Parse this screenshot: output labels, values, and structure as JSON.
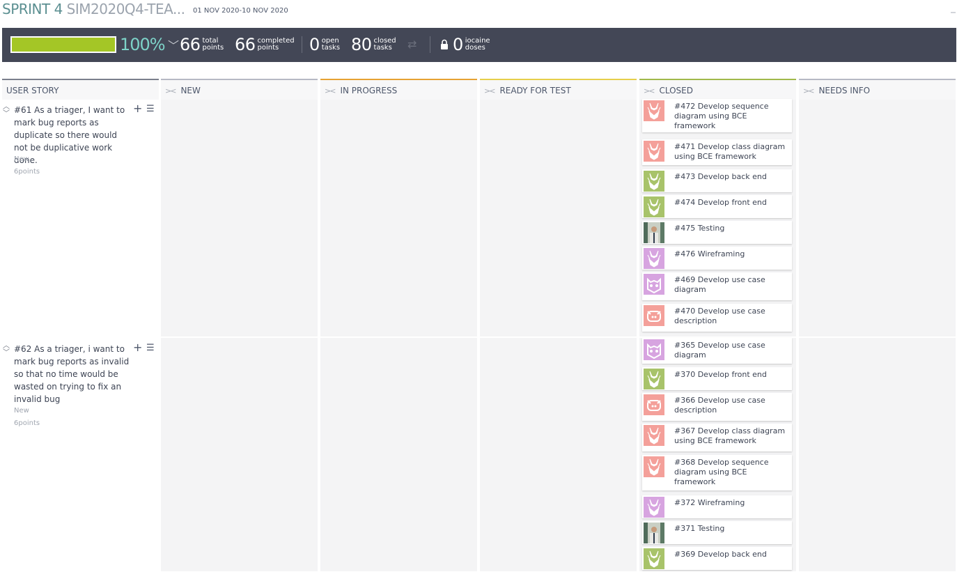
{
  "header": {
    "sprint_name": "SPRINT 4",
    "sprint_project": "SIM2020Q4-TEA...",
    "dates": "01 NOV 2020-10 NOV 2020"
  },
  "stats": {
    "progress_percent": 100,
    "progress_label": "100%",
    "total_points": {
      "value": "66",
      "label1": "total",
      "label2": "points"
    },
    "completed_points": {
      "value": "66",
      "label1": "completed",
      "label2": "points"
    },
    "open_tasks": {
      "value": "0",
      "label1": "open",
      "label2": "tasks"
    },
    "closed_tasks": {
      "value": "80",
      "label1": "closed",
      "label2": "tasks"
    },
    "iocaine_doses": {
      "value": "0",
      "label1": "iocaine",
      "label2": "doses"
    }
  },
  "columns": {
    "user_story": "USER STORY",
    "new": "NEW",
    "in_progress": "IN PROGRESS",
    "ready_for_test": "READY FOR TEST",
    "closed": "CLOSED",
    "needs_info": "NEEDS INFO"
  },
  "colors": {
    "accent": "#5b8f91",
    "progress": "#a4c626",
    "stats_bg": "#434756",
    "in_progress": "#e6a232",
    "ready_for_test": "#e6cf4a",
    "closed": "#a0b94a"
  },
  "stories": [
    {
      "title": "#61 As a triager, I want to mark bug reports as duplicate so there would not be duplicative work done.",
      "status": "New",
      "points": "6points"
    },
    {
      "title": "#62 As a triager, i want to mark bug reports as invalid so that no time would be wasted on trying to fix an invalid bug",
      "status": "New",
      "points": "6points"
    }
  ],
  "tasks": [
    {
      "title": "#472 Develop sequence diagram using BCE framework",
      "avatar": "rabbit-red-icon"
    },
    {
      "title": "#471 Develop class diagram using BCE framework",
      "avatar": "rabbit-red-icon"
    },
    {
      "title": "#473 Develop back end",
      "avatar": "rabbit-green-icon"
    },
    {
      "title": "#474 Develop front end",
      "avatar": "rabbit-green-icon"
    },
    {
      "title": "#475 Testing",
      "avatar": "user-photo-icon"
    },
    {
      "title": "#476 Wireframing",
      "avatar": "rabbit-purple-icon"
    },
    {
      "title": "#469 Develop use case diagram",
      "avatar": "cat-purple-icon"
    },
    {
      "title": "#470 Develop use case description",
      "avatar": "pig-red-icon"
    },
    {
      "title": "#365 Develop use case diagram",
      "avatar": "cat-purple-icon"
    },
    {
      "title": "#370 Develop front end",
      "avatar": "rabbit-green-icon"
    },
    {
      "title": "#366 Develop use case description",
      "avatar": "pig-red-icon"
    },
    {
      "title": "#367 Develop class diagram using BCE framework",
      "avatar": "rabbit-red-icon"
    },
    {
      "title": "#368 Develop sequence diagram using BCE framework",
      "avatar": "rabbit-red-icon"
    },
    {
      "title": "#372 Wireframing",
      "avatar": "rabbit-purple-icon"
    },
    {
      "title": "#371 Testing",
      "avatar": "user-photo-icon"
    },
    {
      "title": "#369 Develop back end",
      "avatar": "rabbit-green-icon"
    }
  ]
}
